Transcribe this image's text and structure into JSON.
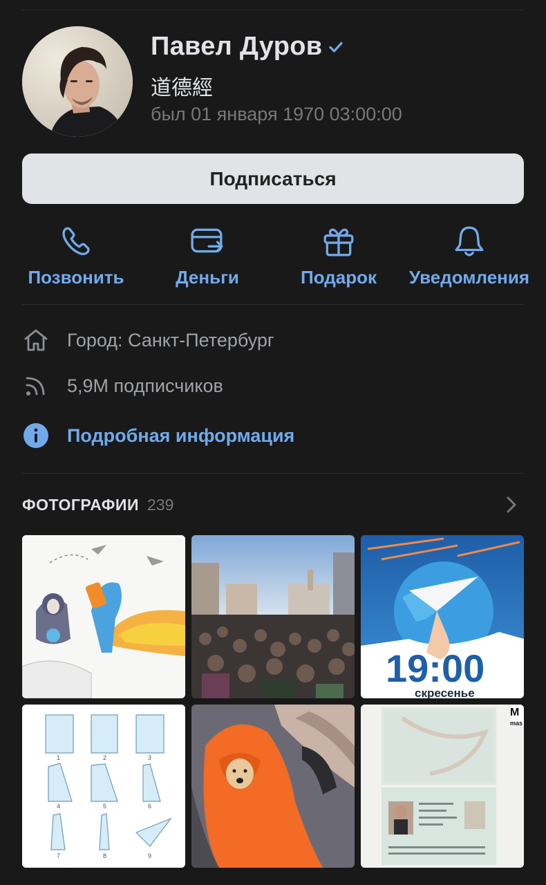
{
  "profile": {
    "name": "Павел Дуров",
    "status": "道德經",
    "last_seen": "был 01 января 1970 03:00:00"
  },
  "subscribe_label": "Подписаться",
  "actions": [
    {
      "label": "Позвонить",
      "icon": "phone-icon"
    },
    {
      "label": "Деньги",
      "icon": "money-transfer-icon"
    },
    {
      "label": "Подарок",
      "icon": "gift-icon"
    },
    {
      "label": "Уведомления",
      "icon": "bell-icon"
    }
  ],
  "info": {
    "city": "Город: Санкт-Петербург",
    "followers": "5,9M подписчиков",
    "details_link": "Подробная информация"
  },
  "photos": {
    "title": "ФОТОГРАФИИ",
    "count": "239",
    "items": [
      {
        "icon": "cartoon-illustration-photo"
      },
      {
        "icon": "crowd-protest-photo"
      },
      {
        "icon": "paper-plane-poster-photo",
        "text": "19:00",
        "subtext": "скресенье"
      },
      {
        "icon": "origami-instructions-photo"
      },
      {
        "icon": "dog-in-sleeping-bag-photo"
      },
      {
        "icon": "passport-scan-photo"
      }
    ]
  },
  "colors": {
    "background": "#19191a",
    "accent": "#71aaeb",
    "button_bg": "#e1e3e6",
    "secondary_text": "#76787a"
  }
}
